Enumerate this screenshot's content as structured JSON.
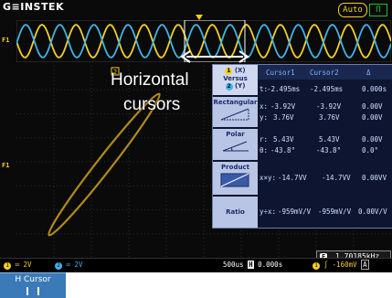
{
  "header": {
    "brand": "G≡INSTEK",
    "mode_badge": "Auto",
    "status_icon": "Π"
  },
  "annotation": {
    "line1": "Horizontal",
    "line2": "cursors"
  },
  "channel_markers": {
    "overview": "F1",
    "plot": "F1",
    "cursor_tag": "2"
  },
  "panel": {
    "header": {
      "c1": "Cursor1",
      "c2": "Cursor2",
      "delta": "Δ"
    },
    "versus": {
      "line1_icon": "1",
      "line1": "(X)",
      "label": "Versus",
      "line2_icon": "2",
      "line2": "(Y)",
      "row": {
        "label": "t:",
        "c1": "-2.495ms",
        "c2": "-2.495ms",
        "delta": "0.000s"
      }
    },
    "rectangular": {
      "label": "Rectangular",
      "x": {
        "label": "x:",
        "c1": "-3.92V",
        "c2": "-3.92V",
        "delta": "0.00V"
      },
      "y": {
        "label": "y:",
        "c1": "3.76V",
        "c2": "3.76V",
        "delta": "0.00V"
      }
    },
    "polar": {
      "label": "Polar",
      "r": {
        "label": "r:",
        "c1": "5.43V",
        "c2": "5.43V",
        "delta": "0.00V"
      },
      "theta": {
        "label": "θ:",
        "c1": "-43.8°",
        "c2": "-43.8°",
        "delta": "0.0°"
      }
    },
    "product": {
      "label": "Product",
      "row": {
        "label": "x×y:",
        "c1": "-14.7VV",
        "c2": "-14.7VV",
        "delta": "0.00VV"
      }
    },
    "ratio": {
      "label": "Ratio",
      "row": {
        "label": "y÷x:",
        "c1": "-959mV/V",
        "c2": "-959mV/V",
        "delta": "0.00V/V"
      }
    }
  },
  "frequency": {
    "icon": "F",
    "value": "1.70185kHz"
  },
  "bottom_bar": {
    "ch1_num": "1",
    "ch1_scale": "2V",
    "ch2_num": "2",
    "ch2_scale": "2V",
    "timebase": "500us",
    "h_icon": "H",
    "position": "0.000s",
    "trig_ch": "1",
    "trig_level": "-160mV",
    "acq_mode": "A"
  },
  "softkey": {
    "label": "H Cursor"
  },
  "colors": {
    "ch1": "#f5d020",
    "ch2": "#3fb4e6",
    "xy_trace": "#b08a1a",
    "panel_bg": "#0e1530",
    "softkey_bg": "#3a7ab8"
  }
}
